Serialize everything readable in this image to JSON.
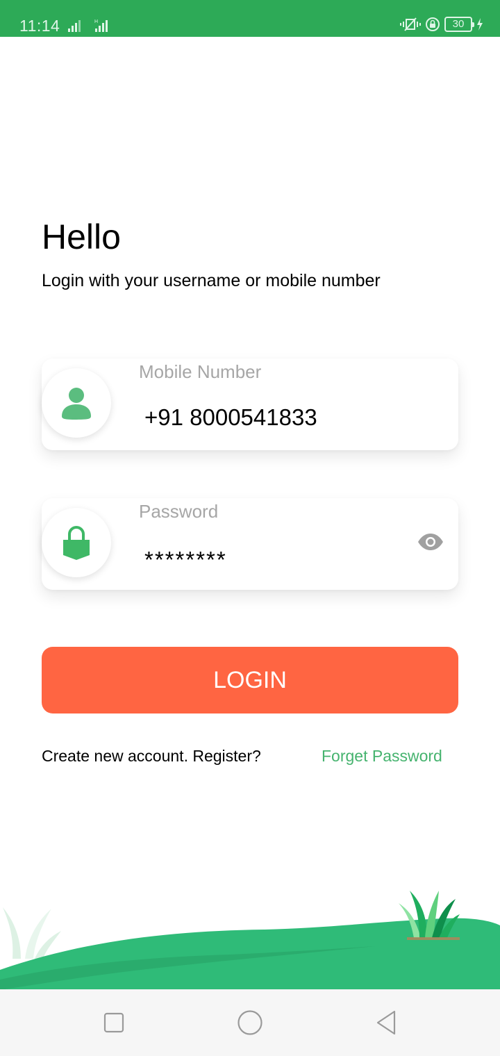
{
  "status_bar": {
    "time": "11:14",
    "battery_level": "30",
    "icons": [
      "signal-icon",
      "signal-h-icon",
      "vibrate-icon",
      "rotation-lock-icon",
      "battery-icon",
      "charging-icon"
    ]
  },
  "header": {
    "title": "Hello",
    "subtitle": "Login with your username or mobile number"
  },
  "form": {
    "mobile": {
      "label": "Mobile Number",
      "value": "+91 8000541833",
      "icon": "user-icon"
    },
    "password": {
      "label": "Password",
      "value": "********",
      "icon": "lock-icon",
      "toggle_icon": "eye-icon"
    },
    "login_label": "LOGIN",
    "register_text": "Create new account. Register?",
    "forgot_text": "Forget Password"
  },
  "nav_bar": {
    "icons": [
      "recent-apps-icon",
      "home-icon",
      "back-icon"
    ]
  },
  "colors": {
    "status_bar": "#2daa57",
    "accent_green": "#45b36e",
    "login_button": "#ff6542",
    "label_gray": "#a6a6a6"
  }
}
